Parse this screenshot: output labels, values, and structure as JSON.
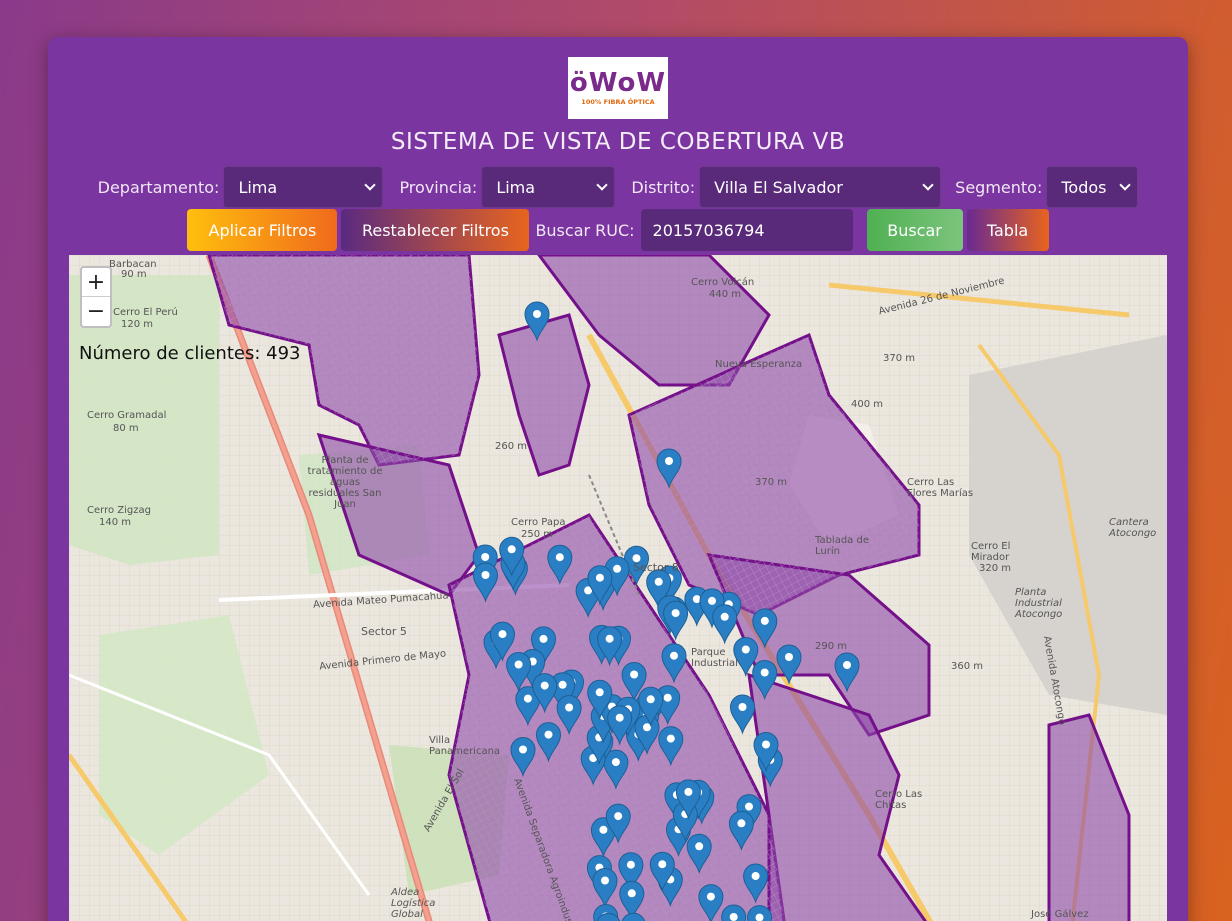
{
  "logo": {
    "word_a": "ö",
    "word_b": "WoW",
    "tagline": "100% FIBRA ÓPTICA"
  },
  "title": "SISTEMA DE VISTA DE COBERTURA VB",
  "filters": {
    "departamento": {
      "label": "Departamento:",
      "value": "Lima"
    },
    "provincia": {
      "label": "Provincia:",
      "value": "Lima"
    },
    "distrito": {
      "label": "Distrito:",
      "value": "Villa El Salvador"
    },
    "segmento": {
      "label": "Segmento:",
      "value": "Todos"
    }
  },
  "actions": {
    "apply": "Aplicar Filtros",
    "reset": "Restablecer Filtros",
    "ruc_label": "Buscar RUC:",
    "ruc_value": "20157036794",
    "search": "Buscar",
    "table": "Tabla"
  },
  "map": {
    "zoom_in": "+",
    "zoom_out": "−",
    "client_count": "Número de clientes: 493",
    "labels": {
      "barbacan": "Barbacan",
      "barbacan_alt": "90 m",
      "cerro_peru": "Cerro El Perú",
      "cerro_peru_alt": "120 m",
      "cerro_gramadal": "Cerro Gramadal",
      "cerro_gramadal_alt": "80 m",
      "cerro_zigzag": "Cerro Zigzag",
      "cerro_zigzag_alt": "140 m",
      "cerro_volcan": "Cerro Volcán",
      "cerro_volcan_alt": "440 m",
      "nueva_esperanza": "Nueva Esperanza",
      "alt_370a": "370 m",
      "alt_400": "400 m",
      "alt_260": "260 m",
      "alt_370b": "370 m",
      "planta": "Planta de tratamiento de aguas residuales San Juan",
      "cerro_papa": "Cerro Papa",
      "cerro_papa_alt": "250 m",
      "sector8": "Sector 8",
      "sector5": "Sector 5",
      "tablada": "Tablada de Lurín",
      "cerro_marias": "Cerro Las Flores Marías",
      "cerro_mirador": "Cerro El Mirador",
      "cerro_mirador_alt": "320 m",
      "cantera": "Cantera Atocongo",
      "planta_industrial": "Planta Industrial Atocongo",
      "parque_industrial": "Parque Industrial",
      "alt_290": "290 m",
      "alt_360": "360 m",
      "villa_panamericana": "Villa Panamericana",
      "cerro_chitas": "Cerro Las Chitas",
      "aldea": "Aldea Logística Global",
      "jose_galvez": "José Gálvez",
      "av_pumacahua": "Avenida Mateo Pumacahua",
      "av_primero_mayo": "Avenida Primero de Mayo",
      "av_26_nov": "Avenida 26 de Noviembre",
      "av_atocongo": "Avenida Atocongo",
      "av_el_sol": "Avenida El Sol",
      "av_separadora": "Avenida Separadora Agroindustrial"
    }
  },
  "colors": {
    "card": "#7a35a0",
    "apply_from": "#ffb40a",
    "apply_to": "#f06a1c",
    "search": "#4caf50",
    "polygon_fill": "#8e4aa8",
    "polygon_stroke": "#7a0a8a",
    "marker": "#2a7fc4"
  }
}
